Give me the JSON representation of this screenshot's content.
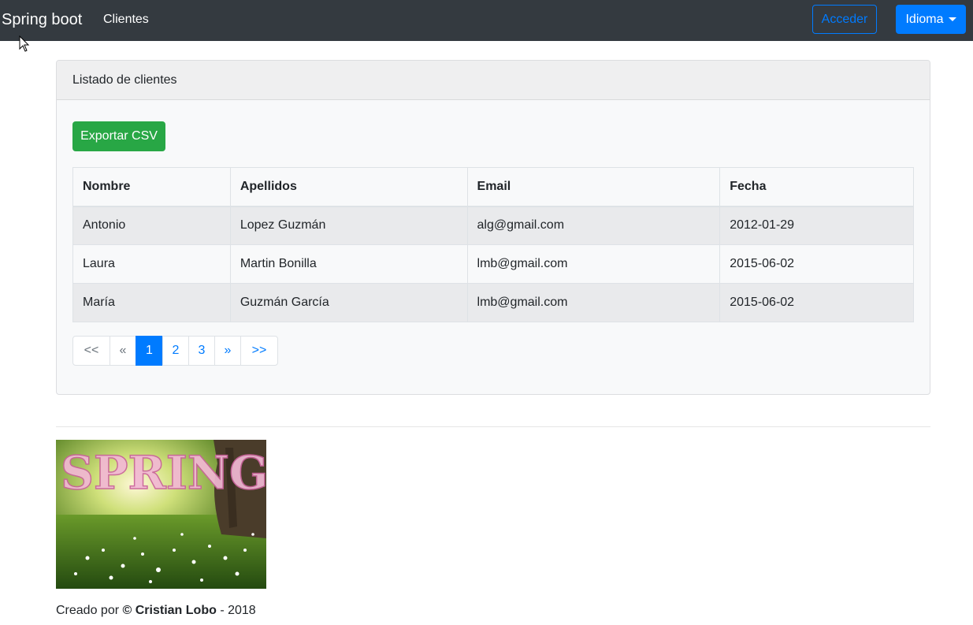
{
  "navbar": {
    "brand": "Spring boot",
    "clientes": "Clientes",
    "acceder": "Acceder",
    "idioma": "Idioma"
  },
  "card": {
    "header": "Listado de clientes",
    "export_label": "Exportar CSV"
  },
  "table": {
    "headers": [
      "Nombre",
      "Apellidos",
      "Email",
      "Fecha"
    ],
    "rows": [
      [
        "Antonio",
        "Lopez Guzmán",
        "alg@gmail.com",
        "2012-01-29"
      ],
      [
        "Laura",
        "Martin Bonilla",
        "lmb@gmail.com",
        "2015-06-02"
      ],
      [
        "María",
        "Guzmán García",
        "lmb@gmail.com",
        "2015-06-02"
      ]
    ]
  },
  "pagination": {
    "first": "<<",
    "prev": "«",
    "pages": [
      "1",
      "2",
      "3"
    ],
    "active_page": "1",
    "next": "»",
    "last": ">>"
  },
  "image": {
    "lettering": "SPRING"
  },
  "footer": {
    "prefix": "Creado por",
    "copyright": "©",
    "author": "Cristian Lobo",
    "separator": "-",
    "year": "2018"
  },
  "colors": {
    "navbar_bg": "#343a40",
    "primary": "#007bff",
    "success": "#28a745"
  }
}
